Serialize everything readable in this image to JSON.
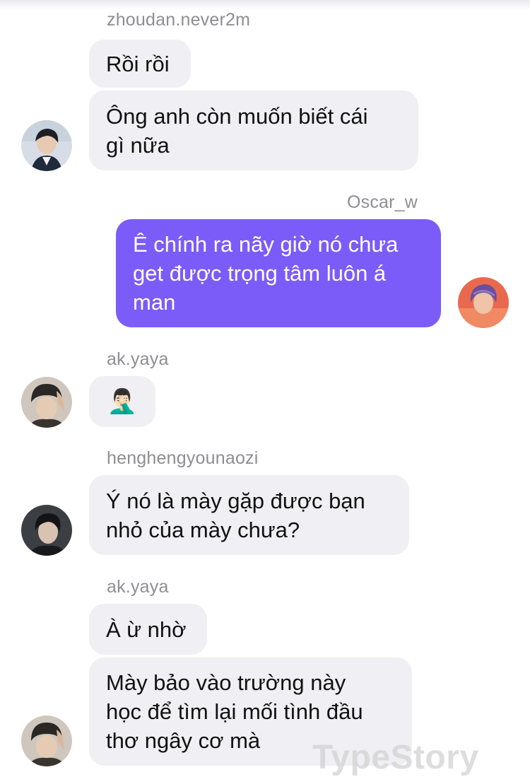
{
  "messages": [
    {
      "sender": "zhoudan.never2m",
      "bubbles": [
        "Rồi rồi",
        "Ông anh còn muốn biết cái\ngì nữa"
      ]
    },
    {
      "sender": "Oscar_w",
      "bubbles": [
        "Ê chính ra nãy giờ nó chưa\nget được trọng tâm luôn á\nman"
      ]
    },
    {
      "sender": "ak.yaya",
      "bubbles": [
        "🤦🏻‍♂️"
      ]
    },
    {
      "sender": "henghengyounaozi",
      "bubbles": [
        "Ý nó là mày gặp được bạn\nnhỏ của mày chưa?"
      ]
    },
    {
      "sender": "ak.yaya",
      "bubbles": [
        "À ừ nhờ",
        "Mày bảo vào trường này\nhọc để tìm lại mối tình đầu\nthơ ngây cơ mà"
      ]
    }
  ],
  "watermark": "TypeStory",
  "colors": {
    "outgoing_bubble": "#7b5cf8",
    "incoming_bubble": "#efeff4",
    "username_text": "#8e8e93"
  },
  "icons": [
    "avatar-zhoudan",
    "avatar-oscar",
    "avatar-akyaya",
    "avatar-henghengyounaozi"
  ]
}
